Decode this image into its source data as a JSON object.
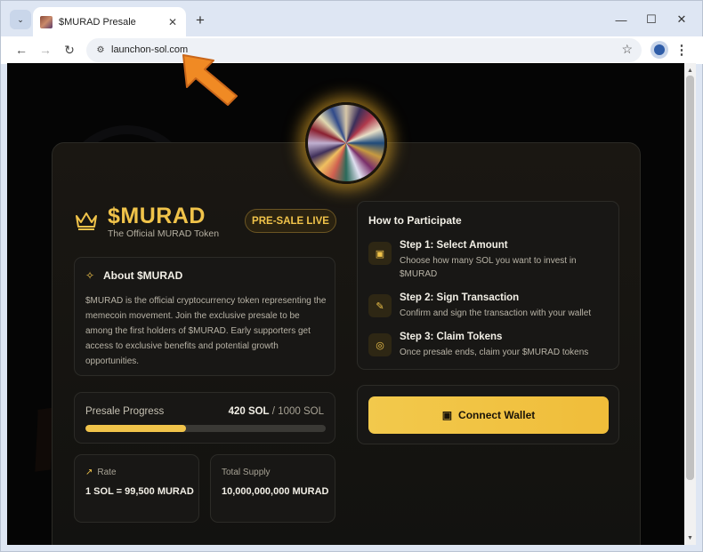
{
  "browser": {
    "tab_title": "$MURAD Presale",
    "url": "launchon-sol.com",
    "new_tab": "+",
    "minimize": "—",
    "maximize": "☐",
    "close": "✕"
  },
  "page": {
    "brand": "$MURAD",
    "brand_subtitle": "The Official MURAD Token",
    "badge": "PRE-SALE LIVE",
    "watermark": "risk.com",
    "about": {
      "title": "About $MURAD",
      "text": "$MURAD is the official cryptocurrency token representing the memecoin movement. Join the exclusive presale to be among the first holders of $MURAD. Early supporters get access to exclusive benefits and potential growth opportunities."
    },
    "progress": {
      "label": "Presale Progress",
      "raised": "420 SOL",
      "separator": "/",
      "goal": "1000 SOL",
      "fraction": 0.42
    },
    "rate": {
      "label": "Rate",
      "value": "1 SOL = 99,500 MURAD"
    },
    "supply": {
      "label": "Total Supply",
      "value": "10,000,000,000 MURAD"
    },
    "howto": {
      "title": "How to Participate",
      "steps": [
        {
          "title": "Step 1: Select Amount",
          "desc": "Choose how many SOL you want to invest in $MURAD",
          "icon": "wallet-icon"
        },
        {
          "title": "Step 2: Sign Transaction",
          "desc": "Confirm and sign the transaction with your wallet",
          "icon": "sign-icon"
        },
        {
          "title": "Step 3: Claim Tokens",
          "desc": "Once presale ends, claim your $MURAD tokens",
          "icon": "coins-icon"
        }
      ]
    },
    "connect_button": "Connect Wallet"
  },
  "colors": {
    "accent": "#f0c34a",
    "background": "#050505",
    "panel": "#181715"
  }
}
